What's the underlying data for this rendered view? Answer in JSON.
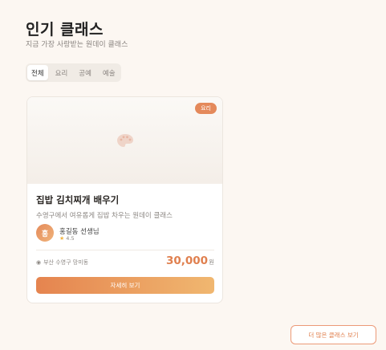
{
  "header": {
    "title": "인기 클래스",
    "subtitle": "지금 가장 사랑받는 원데이 클래스"
  },
  "tabs": [
    {
      "label": "전체",
      "active": true
    },
    {
      "label": "요리",
      "active": false
    },
    {
      "label": "공예",
      "active": false
    },
    {
      "label": "예술",
      "active": false
    }
  ],
  "card": {
    "image_icon": "palette-icon",
    "badge": "요리",
    "title": "집밥 김치찌개 배우기",
    "description": "수영구에서 여유롭게 집밥 차우는 원데이 클래스",
    "instructor": {
      "avatar_initial": "홍",
      "name": "홍길동 선생님",
      "rating": "4.5"
    },
    "location": "부산 수영구 망미동",
    "price": "30,000",
    "price_unit": "원",
    "cta_label": "자세히 보기"
  },
  "more_button_label": "더 많은 클래스 보기",
  "colors": {
    "accent": "#e0804f",
    "accent_light": "#f0b770",
    "background": "#fcf7f2"
  }
}
